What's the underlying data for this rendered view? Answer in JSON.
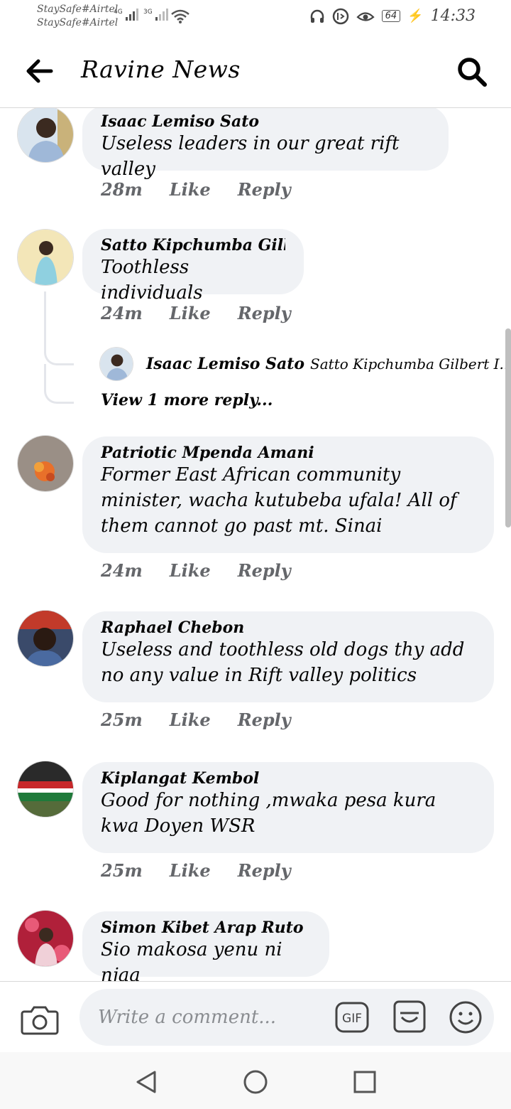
{
  "status_bar": {
    "carrier_1": "StaySafe#Airtel",
    "carrier_2": "StaySafe#Airtel",
    "network_1": "4G",
    "network_2": "3G",
    "battery": "64",
    "time": "14:33"
  },
  "header": {
    "title": "Ravine News",
    "back_icon": "back-arrow-icon",
    "search_icon": "search-icon"
  },
  "comments": [
    {
      "author": "Isaac Lemiso Sato",
      "text": "Useless leaders in our great rift valley",
      "time": "28m",
      "like": "Like",
      "reply": "Reply"
    },
    {
      "author": "Satto Kipchumba Gilbert",
      "text": "Toothless individuals",
      "time": "24m",
      "like": "Like",
      "reply": "Reply",
      "reply_preview": {
        "author": "Isaac Lemiso Sato",
        "text": "Satto Kipchumba Gilbert I..."
      },
      "view_more": "View 1 more reply..."
    },
    {
      "author": "Patriotic Mpenda Amani",
      "text": "Former East African community minister, wacha kutubeba ufala! All of them cannot go past mt. Sinai",
      "time": "24m",
      "like": "Like",
      "reply": "Reply"
    },
    {
      "author": "Raphael Chebon",
      "text": "Useless and  toothless old dogs thy add no any value in Rift valley politics",
      "time": "25m",
      "like": "Like",
      "reply": "Reply"
    },
    {
      "author": "Kiplangat Kembol",
      "text": "Good for nothing ,mwaka pesa kura kwa Doyen WSR",
      "time": "25m",
      "like": "Like",
      "reply": "Reply"
    },
    {
      "author": "Simon Kibet Arap Ruto",
      "text": "Sio makosa yenu ni njaa"
    }
  ],
  "composer": {
    "placeholder": "Write a comment...",
    "camera_icon": "camera-icon",
    "gif_icon": "gif-icon",
    "sticker_icon": "sticker-icon",
    "emoji_icon": "emoji-icon"
  },
  "colors": {
    "bubble": "#f0f2f5",
    "meta_text": "#65676b",
    "primary_text": "#050505"
  }
}
